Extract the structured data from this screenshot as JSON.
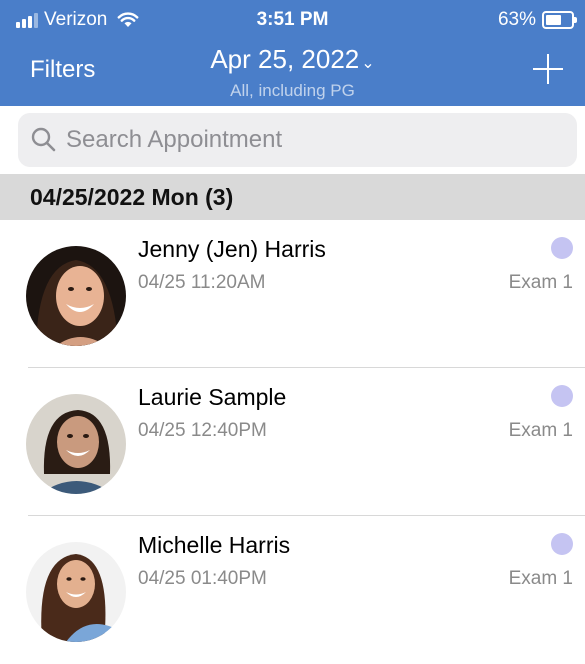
{
  "status_bar": {
    "carrier": "Verizon",
    "time": "3:51 PM",
    "battery": "63%",
    "battery_level": 0.63,
    "icons": [
      "signal-icon",
      "wifi-icon",
      "battery-icon"
    ]
  },
  "nav": {
    "filters_label": "Filters",
    "date_title": "Apr 25, 2022",
    "subtitle": "All, including PG",
    "add_icon": "plus-icon"
  },
  "search": {
    "placeholder": "Search Appointment",
    "value": ""
  },
  "section": {
    "label": "04/25/2022 Mon (3)"
  },
  "appointments": [
    {
      "name": "Jenny (Jen) Harris",
      "time": "04/25 11:20AM",
      "room": "Exam 1"
    },
    {
      "name": "Laurie Sample",
      "time": "04/25 12:40PM",
      "room": "Exam 1"
    },
    {
      "name": "Michelle Harris",
      "time": "04/25 01:40PM",
      "room": "Exam 1"
    }
  ],
  "colors": {
    "header": "#4a7ec9",
    "status_dot": "#c5c4f2",
    "section_bg": "#d9d9d9"
  }
}
